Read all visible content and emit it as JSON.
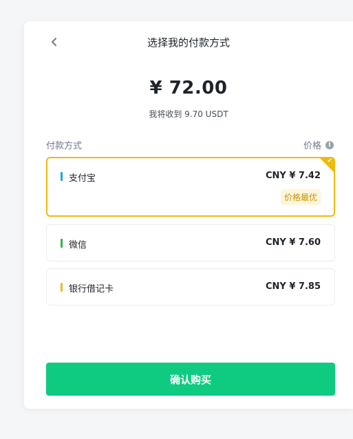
{
  "header": {
    "title": "选择我的付款方式",
    "back_icon": "chevron-left-icon"
  },
  "summary": {
    "amount": "¥ 72.00",
    "receive_text": "我将收到 9.70 USDT"
  },
  "list_header": {
    "method_label": "付款方式",
    "price_label": "价格",
    "info_icon": "i"
  },
  "methods": [
    {
      "name": "支付宝",
      "price": "CNY ¥ 7.42",
      "badge": "价格最优",
      "color": "#1aa3e8",
      "selected": true
    },
    {
      "name": "微信",
      "price": "CNY ¥ 7.60",
      "color": "#2fb54b",
      "selected": false
    },
    {
      "name": "银行借记卡",
      "price": "CNY ¥ 7.85",
      "color": "#e8b923",
      "selected": false
    }
  ],
  "confirm_label": "确认购买",
  "colors": {
    "accent_yellow": "#f0b90b",
    "confirm_green": "#0ecb81"
  }
}
